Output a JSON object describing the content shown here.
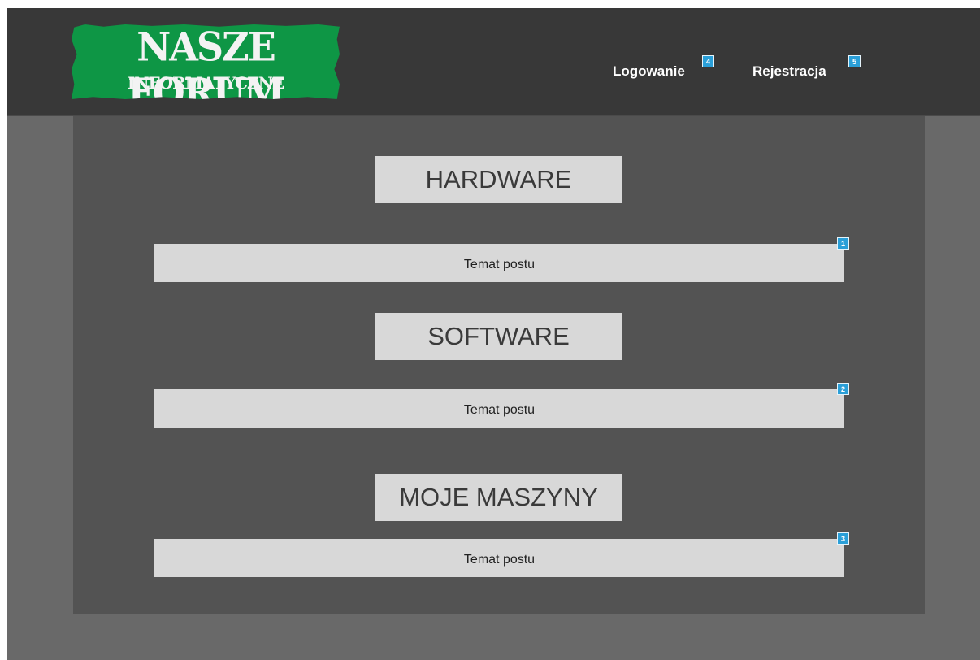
{
  "header": {
    "logo": {
      "title": "NASZE FORUM",
      "subtitle": "INFORMATYCZNE"
    },
    "nav": [
      {
        "label": "Logowanie",
        "badge": "4"
      },
      {
        "label": "Rejestracja",
        "badge": "5"
      }
    ]
  },
  "sections": [
    {
      "category": "HARDWARE",
      "post": {
        "label": "Temat postu",
        "badge": "1"
      }
    },
    {
      "category": "SOFTWARE",
      "post": {
        "label": "Temat postu",
        "badge": "2"
      }
    },
    {
      "category": "MOJE MASZYNY",
      "post": {
        "label": "Temat postu",
        "badge": "3"
      }
    }
  ],
  "colors": {
    "header_bg": "#383838",
    "content_bg": "#535353",
    "page_bg": "#696969",
    "logo_green": "#0e9645",
    "badge_blue": "#2a9fd8",
    "box_bg": "#d8d8d8"
  }
}
